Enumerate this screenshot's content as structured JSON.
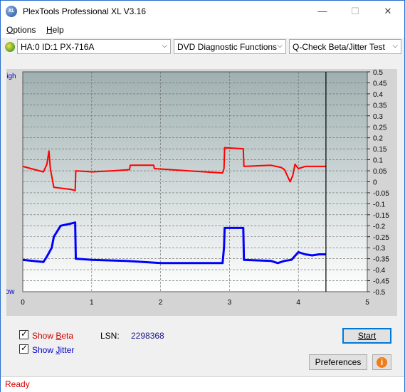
{
  "window": {
    "title": "PlexTools Professional XL V3.16",
    "app_icon": "XL",
    "minimize_symbol": "—",
    "maximize_symbol": "☐",
    "close_symbol": "✕"
  },
  "menu": [
    {
      "label": "Options",
      "accel": "O"
    },
    {
      "label": "Help",
      "accel": "H"
    }
  ],
  "toolbar": {
    "drive": "HA:0 ID:1  PX-716A",
    "function": "DVD Diagnostic Functions",
    "test": "Q-Check Beta/Jitter Test"
  },
  "chart": {
    "high_label": "High",
    "low_label": "Low",
    "background_top": "#9fb0b0",
    "background_bottom": "#ffffff",
    "marker_x": 4.4
  },
  "chart_data": {
    "type": "line",
    "xlim": [
      0,
      5
    ],
    "x_ticks": [
      "0",
      "1",
      "2",
      "3",
      "4",
      "5"
    ],
    "ylim": [
      -0.5,
      0.5
    ],
    "y_ticks": [
      "0.5",
      "0.45",
      "0.4",
      "0.35",
      "0.3",
      "0.25",
      "0.2",
      "0.15",
      "0.1",
      "0.05",
      "0",
      "-0.05",
      "-0.1",
      "-0.15",
      "-0.2",
      "-0.25",
      "-0.3",
      "-0.35",
      "-0.4",
      "-0.45",
      "-0.5"
    ],
    "grid": true,
    "series": [
      {
        "color": "#ff0000",
        "x": [
          0,
          0.3,
          0.35,
          0.38,
          0.4,
          0.45,
          0.7,
          0.76,
          0.77,
          1.0,
          1.3,
          1.55,
          1.56,
          1.9,
          1.91,
          2.4,
          2.9,
          2.92,
          2.93,
          3.2,
          3.21,
          3.6,
          3.75,
          3.8,
          3.85,
          3.88,
          3.92,
          3.95,
          4.0,
          4.1,
          4.4
        ],
        "y": [
          0.07,
          0.045,
          0.08,
          0.14,
          0.06,
          -0.025,
          -0.035,
          -0.04,
          0.05,
          0.045,
          0.05,
          0.055,
          0.075,
          0.075,
          0.06,
          0.05,
          0.04,
          0.06,
          0.155,
          0.15,
          0.07,
          0.075,
          0.065,
          0.055,
          0.02,
          0.0,
          0.03,
          0.08,
          0.06,
          0.07,
          0.07
        ]
      },
      {
        "color": "#0000ff",
        "x": [
          0,
          0.3,
          0.35,
          0.42,
          0.45,
          0.55,
          0.7,
          0.76,
          0.77,
          1.0,
          1.5,
          2.0,
          2.5,
          2.9,
          2.92,
          2.93,
          3.2,
          3.21,
          3.6,
          3.7,
          3.8,
          3.9,
          4.0,
          4.1,
          4.2,
          4.3,
          4.4
        ],
        "y": [
          -0.355,
          -0.365,
          -0.34,
          -0.3,
          -0.25,
          -0.2,
          -0.19,
          -0.185,
          -0.35,
          -0.355,
          -0.36,
          -0.37,
          -0.37,
          -0.37,
          -0.3,
          -0.21,
          -0.21,
          -0.355,
          -0.36,
          -0.37,
          -0.36,
          -0.355,
          -0.32,
          -0.33,
          -0.335,
          -0.33,
          -0.33
        ]
      }
    ]
  },
  "controls": {
    "show_beta_label": "Show Beta",
    "show_beta_accel": "B",
    "show_beta_checked": true,
    "show_jitter_label": "Show Jitter",
    "show_jitter_accel": "J",
    "show_jitter_checked": true,
    "lsn_label": "LSN:",
    "lsn_value": "2298368",
    "start_label": "Start",
    "preferences_label": "Preferences",
    "info_icon": "i"
  },
  "status": {
    "text": "Ready"
  }
}
